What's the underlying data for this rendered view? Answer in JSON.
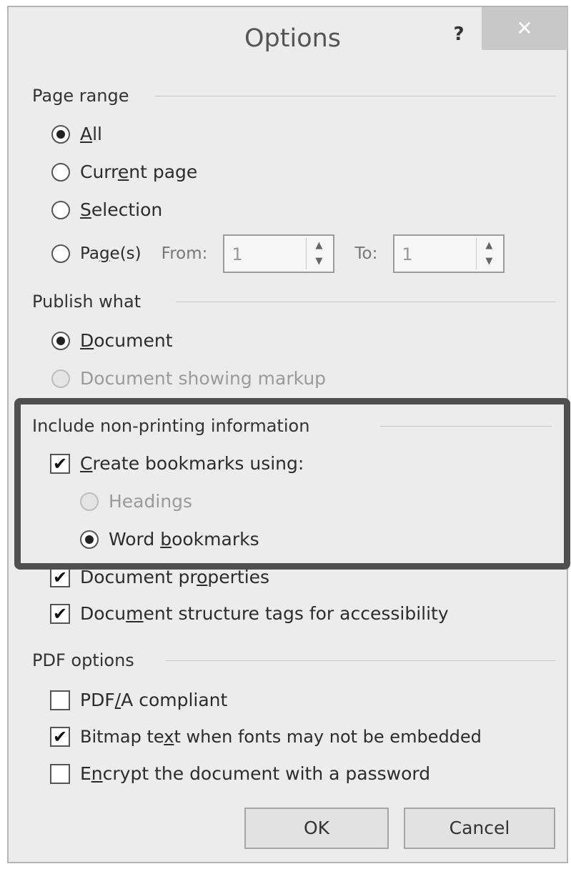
{
  "window": {
    "title": "Options",
    "help_label": "?",
    "close_label": "✕"
  },
  "page_range": {
    "label": "Page range",
    "options": {
      "all": {
        "pre": "",
        "accel": "A",
        "post": "ll",
        "checked": true
      },
      "current": {
        "pre": "Curr",
        "accel": "e",
        "post": "nt page",
        "checked": false
      },
      "selection": {
        "pre": "",
        "accel": "S",
        "post": "election",
        "checked": false
      },
      "pages": {
        "pre": "Pa",
        "accel": "g",
        "post": "e(s)",
        "checked": false
      }
    },
    "from_label": "From:",
    "from_value": "1",
    "to_label": "To:",
    "to_value": "1"
  },
  "publish_what": {
    "label": "Publish what",
    "document": {
      "pre": "",
      "accel": "D",
      "post": "ocument",
      "checked": true
    },
    "markup": {
      "label": "Document showing markup",
      "enabled": false
    }
  },
  "non_printing": {
    "label": "Include non-printing information",
    "create_bookmarks": {
      "pre": "",
      "accel": "C",
      "post": "reate bookmarks using:",
      "checked": true
    },
    "headings": {
      "label": "Headings",
      "enabled": false
    },
    "word_bookmarks": {
      "pre": "Word ",
      "accel": "b",
      "post": "ookmarks",
      "checked": true
    },
    "doc_properties": {
      "pre": "Document pr",
      "accel": "o",
      "post": "perties",
      "checked": true
    },
    "structure_tags": {
      "pre": "Docu",
      "accel": "m",
      "post": "ent structure tags for accessibility",
      "checked": true
    }
  },
  "pdf_options": {
    "label": "PDF options",
    "pdfa": {
      "pre": "PDF",
      "accel": "/",
      "post": "A compliant",
      "checked": false
    },
    "bitmap": {
      "pre": "Bitmap te",
      "accel": "x",
      "post": "t when fonts may not be embedded",
      "checked": true
    },
    "encrypt": {
      "pre": "E",
      "accel": "n",
      "post": "crypt the document with a password",
      "checked": false
    }
  },
  "buttons": {
    "ok": "OK",
    "cancel": "Cancel"
  },
  "check_glyph": "✔",
  "colors": {
    "dialog_bg": "#ececec",
    "highlight_border": "#4f4f4f",
    "disabled_text": "#9a9a9a"
  }
}
